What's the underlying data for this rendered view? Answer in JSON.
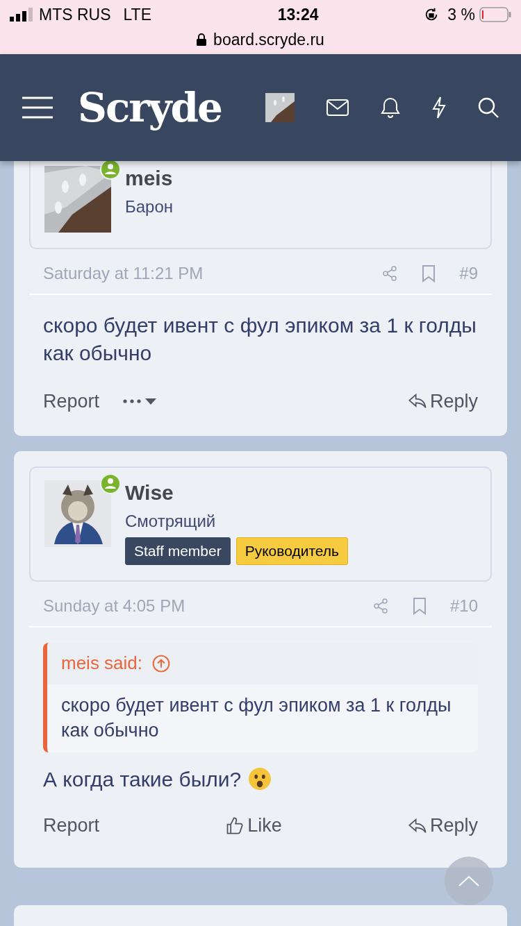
{
  "status_bar": {
    "carrier": "MTS RUS",
    "network": "LTE",
    "time": "13:24",
    "battery": "3 %",
    "url": "board.scryde.ru"
  },
  "header": {
    "logo": "Scryde"
  },
  "posts": [
    {
      "author": "meis",
      "title": "Барон",
      "online": true,
      "date": "Saturday at 11:21 PM",
      "number": "#9",
      "message": "скоро будет ивент с фул эпиком за 1 к голды как обычно",
      "emoji": false,
      "actions": [
        {
          "kind": "report",
          "label": "Report"
        },
        {
          "kind": "more"
        },
        {
          "kind": "reply",
          "label": "Reply"
        }
      ]
    },
    {
      "author": "Wise",
      "title": "Смотрящий",
      "online": true,
      "badges": [
        {
          "label": "Staff member",
          "kind": "staff"
        },
        {
          "label": "Руководитель",
          "kind": "role"
        }
      ],
      "date": "Sunday at 4:05 PM",
      "number": "#10",
      "quote": {
        "attribution": "meis said:",
        "text": "скоро будет ивент с фул эпиком за 1 к голды как обычно"
      },
      "message": "А когда такие были?",
      "emoji": true,
      "actions": [
        {
          "kind": "report",
          "label": "Report"
        },
        {
          "kind": "like",
          "label": "Like"
        },
        {
          "kind": "reply",
          "label": "Reply"
        }
      ]
    }
  ]
}
